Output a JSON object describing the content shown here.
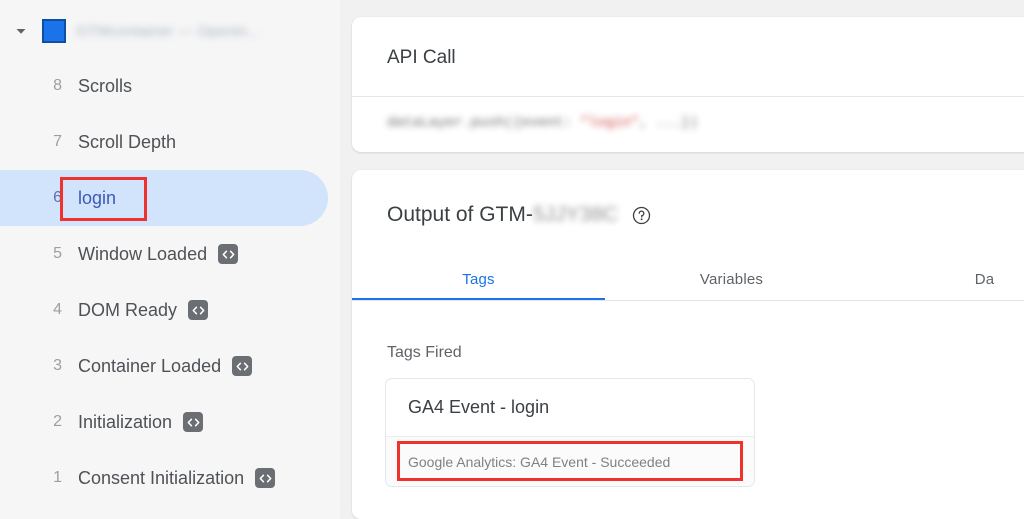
{
  "sidebar": {
    "expand_icon": "chevron-down-icon",
    "container_swatch_color": "#1a73e8",
    "container_name": "GTMcontainer — Openin...",
    "container_name_redacted": true,
    "events": [
      {
        "num": "8",
        "label": "Scrolls",
        "has_code_icon": false,
        "selected": false
      },
      {
        "num": "7",
        "label": "Scroll Depth",
        "has_code_icon": false,
        "selected": false
      },
      {
        "num": "6",
        "label": "login",
        "has_code_icon": false,
        "selected": true
      },
      {
        "num": "5",
        "label": "Window Loaded",
        "has_code_icon": true,
        "selected": false
      },
      {
        "num": "4",
        "label": "DOM Ready",
        "has_code_icon": true,
        "selected": false
      },
      {
        "num": "3",
        "label": "Container Loaded",
        "has_code_icon": true,
        "selected": false
      },
      {
        "num": "2",
        "label": "Initialization",
        "has_code_icon": true,
        "selected": false
      },
      {
        "num": "1",
        "label": "Consent Initialization",
        "has_code_icon": true,
        "selected": false
      }
    ],
    "code_icon_name": "code-icon"
  },
  "api_call": {
    "title": "API Call",
    "code_prefix": "dataLayer.push({event: ",
    "code_string": "\"login\"",
    "code_suffix": ", ...})",
    "code_redacted": true
  },
  "output": {
    "title_prefix": "Output of GTM-",
    "container_id": "5JJY38C",
    "container_id_redacted": true,
    "help_icon": "help-circle-icon",
    "tabs": [
      {
        "label": "Tags",
        "active": true
      },
      {
        "label": "Variables",
        "active": false
      },
      {
        "label": "Da",
        "active": false
      }
    ],
    "tags_fired_label": "Tags Fired",
    "tag_cards": [
      {
        "name": "GA4 Event - login",
        "status": "Google Analytics: GA4 Event - Succeeded",
        "status_highlighted": true
      }
    ]
  },
  "colors": {
    "accent": "#1a73e8",
    "selected_row_bg": "#d2e3fc",
    "highlight_box": "#f0322e",
    "sidebar_bg": "#f6f6f6",
    "page_bg": "#f1f1f1",
    "code_string": "#c5221f"
  }
}
